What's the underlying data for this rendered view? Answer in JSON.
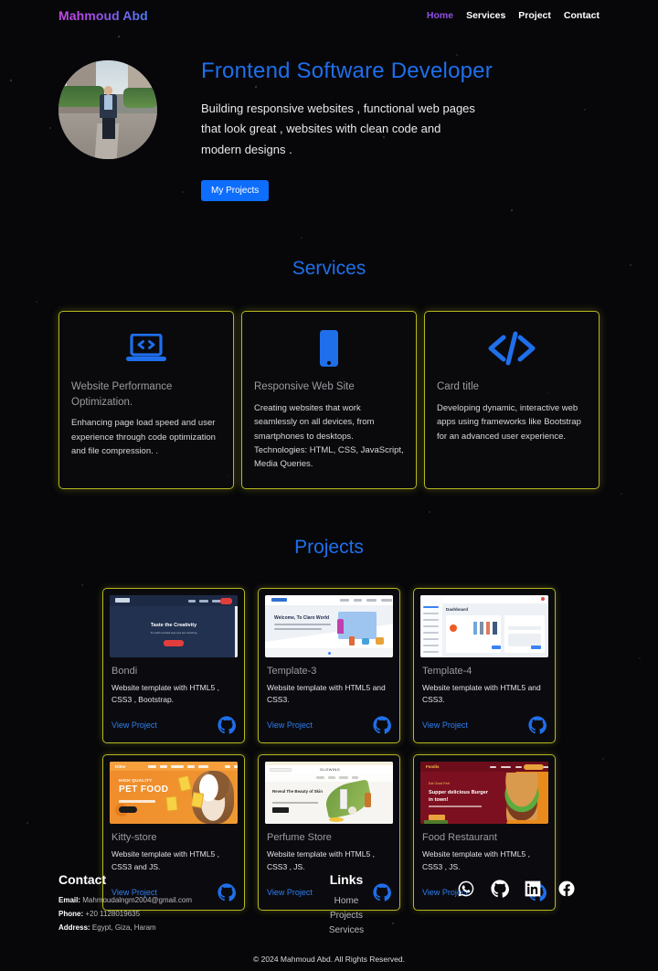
{
  "brand": "Mahmoud Abd",
  "nav": {
    "items": [
      {
        "label": "Home",
        "active": true
      },
      {
        "label": "Services",
        "active": false
      },
      {
        "label": "Project",
        "active": false
      },
      {
        "label": "Contact",
        "active": false
      }
    ]
  },
  "hero": {
    "avatar_alt": "profile-photo",
    "title": "Frontend Software Developer",
    "description": "Building responsive websites , functional web pages that look great , websites with clean code and modern designs .",
    "cta_label": "My Projects",
    "accent_color": "#1f6feb",
    "button_color": "#0d6efd"
  },
  "services": {
    "title": "Services",
    "border_color": "#b5b721",
    "icon_color": "#1f6feb",
    "cards": [
      {
        "icon": "laptop-code-icon",
        "title": "Website Performance Optimization.",
        "body": "Enhancing page load speed and user experience through code optimization and file compression. ."
      },
      {
        "icon": "mobile-phone-icon",
        "title": "Responsive Web Site",
        "body": "Creating websites that work seamlessly on all devices, from smartphones to desktops. Technologies: HTML, CSS, JavaScript, Media Queries."
      },
      {
        "icon": "code-brackets-icon",
        "title": "Card title",
        "body": "Developing dynamic, interactive web apps using frameworks like Bootstrap for an advanced user experience."
      }
    ]
  },
  "projects": {
    "title": "Projects",
    "link_label": "View Project",
    "repo_icon": "github-icon",
    "items": [
      {
        "thumb": "bondi-template-thumbnail",
        "name": "Bondi",
        "description": "Website template with HTML5 , CSS3 , Bootstrap.",
        "thumb_text": {
          "headline": "Taste the Creativity",
          "sub": "To catch excited sign ups are amazing",
          "button": "IT'S UP"
        }
      },
      {
        "thumb": "template-3-thumbnail",
        "name": "Template-3",
        "description": "Website template with HTML5 and CSS3.",
        "thumb_text": {
          "headline": "Welcome, To Claro World"
        }
      },
      {
        "thumb": "template-4-thumbnail",
        "name": "Template-4",
        "description": "Website template with HTML5 and CSS3.",
        "thumb_text": {
          "headline": "Dashboard"
        }
      },
      {
        "thumb": "kitty-store-thumbnail",
        "name": "Kitty-store",
        "description": "Website template with HTML5 , CSS3 and JS.",
        "thumb_text": {
          "eyebrow": "HIGH QUALITY",
          "headline": "PET FOOD"
        }
      },
      {
        "thumb": "perfume-store-thumbnail",
        "name": "Perfume Store",
        "description": "Website template with HTML5 , CSS3 , JS.",
        "thumb_text": {
          "logo": "GLOWING",
          "headline": "Reveal The Beauty of Skin"
        }
      },
      {
        "thumb": "food-restaurant-thumbnail",
        "name": "Food Restaurant",
        "description": "Website template with HTML5 , CSS3 , JS.",
        "thumb_text": {
          "eyebrow": "Eat Good Feel",
          "headline": "Supper delicious Burger in town!"
        }
      }
    ]
  },
  "footer": {
    "contact": {
      "heading": "Contact",
      "email_label": "Email:",
      "email_value": "Mahmoudalngm2004@gmail.com",
      "phone_label": "Phone:",
      "phone_value": "+20 1128019635",
      "address_label": "Address:",
      "address_value": "Egypt, Giza, Haram"
    },
    "links": {
      "heading": "Links",
      "items": [
        "Home",
        "Projects",
        "Services"
      ]
    },
    "social": [
      {
        "icon": "whatsapp-icon",
        "name": "WhatsApp"
      },
      {
        "icon": "github-icon",
        "name": "GitHub"
      },
      {
        "icon": "linkedin-icon",
        "name": "LinkedIn"
      },
      {
        "icon": "facebook-icon",
        "name": "Facebook"
      }
    ],
    "copyright": "© 2024 Mahmoud Abd. All Rights Reserved."
  }
}
